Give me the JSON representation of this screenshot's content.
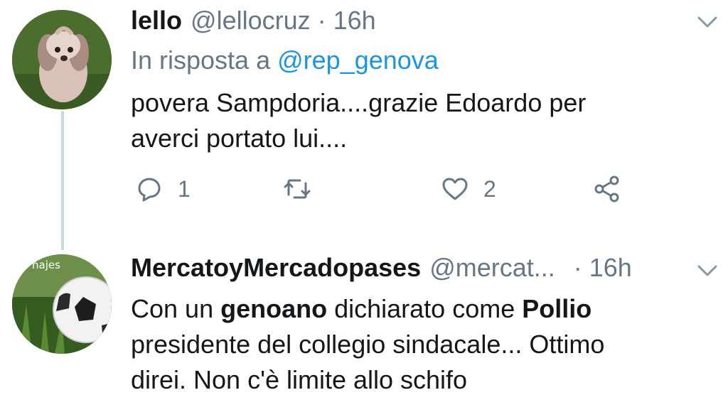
{
  "tweets": [
    {
      "display_name": "lello",
      "handle": "@lellocruz",
      "separator": "·",
      "time": "16h",
      "reply_prefix": "In risposta a",
      "reply_mention": "@rep_genova",
      "text_line1": "povera Sampdoria....grazie Edoardo per",
      "text_line2": "averci portato lui....",
      "actions": {
        "reply_count": "1",
        "like_count": "2"
      }
    },
    {
      "display_name": "MercatoyMercadopases",
      "handle": "@mercat...",
      "separator": "·",
      "time": "16h",
      "avatar_text": "najes",
      "text_parts": {
        "p1": "Con un ",
        "b1": "genoano",
        "p2": " dichiarato come ",
        "b2": "Pollio",
        "line2": "presidente del collegio sindacale... Ottimo",
        "line3": "direi. Non c'è limite allo schifo"
      }
    }
  ],
  "colors": {
    "link": "#1b95e0",
    "secondary": "#657786",
    "thread_line": "#ccd6dd"
  },
  "icons": [
    "chevron-down-icon",
    "reply-icon",
    "retweet-icon",
    "like-icon",
    "share-icon"
  ]
}
